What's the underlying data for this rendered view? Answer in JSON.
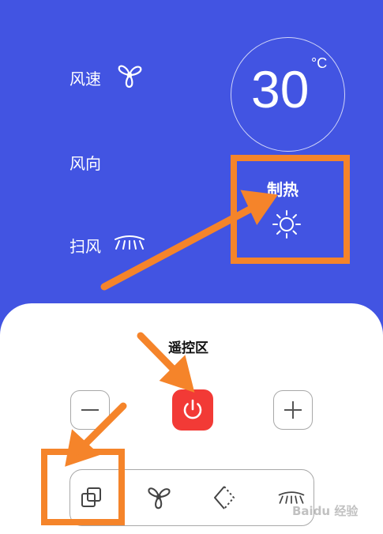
{
  "controls": {
    "fan_speed_label": "风速",
    "fan_direction_label": "风向",
    "swing_label": "扫风"
  },
  "temperature": {
    "value": "30",
    "unit": "°C"
  },
  "mode": {
    "label": "制热",
    "icon": "sun-icon"
  },
  "remote": {
    "title": "遥控区"
  },
  "watermark": "Baidu 经验",
  "colors": {
    "background": "#4254e2",
    "panel": "#ffffff",
    "power": "#f23a36",
    "annotation": "#f5842a"
  }
}
